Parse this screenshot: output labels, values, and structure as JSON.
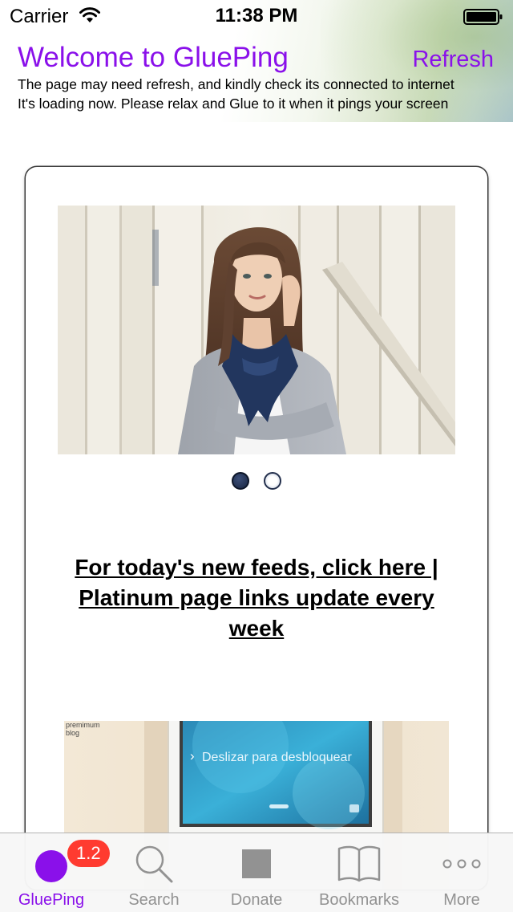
{
  "status_bar": {
    "carrier": "Carrier",
    "time": "11:38 PM"
  },
  "header": {
    "title": "Welcome to GluePing",
    "refresh_label": "Refresh",
    "info_line_1": "The page may need refresh, and kindly check its connected to internet",
    "info_line_2": "It's loading now. Please relax and Glue to it when it pings your screen"
  },
  "feed": {
    "carousel": {
      "page_count": 2,
      "current_page": 1
    },
    "link_text": "For today's new feeds, click here | Platinum page links update every week",
    "blog_image": {
      "label": "premimum blog",
      "slide_text": "Deslizar para desbloquear"
    }
  },
  "tab_bar": {
    "items": [
      {
        "label": "GluePing",
        "icon": "glueping-dot-icon",
        "badge": "1.2",
        "active": true
      },
      {
        "label": "Search",
        "icon": "search-icon"
      },
      {
        "label": "Donate",
        "icon": "donate-icon"
      },
      {
        "label": "Bookmarks",
        "icon": "bookmarks-icon"
      },
      {
        "label": "More",
        "icon": "more-icon"
      }
    ]
  },
  "colors": {
    "accent": "#8a10ea",
    "badge": "#ff3b30",
    "tab_inactive": "#929292"
  }
}
